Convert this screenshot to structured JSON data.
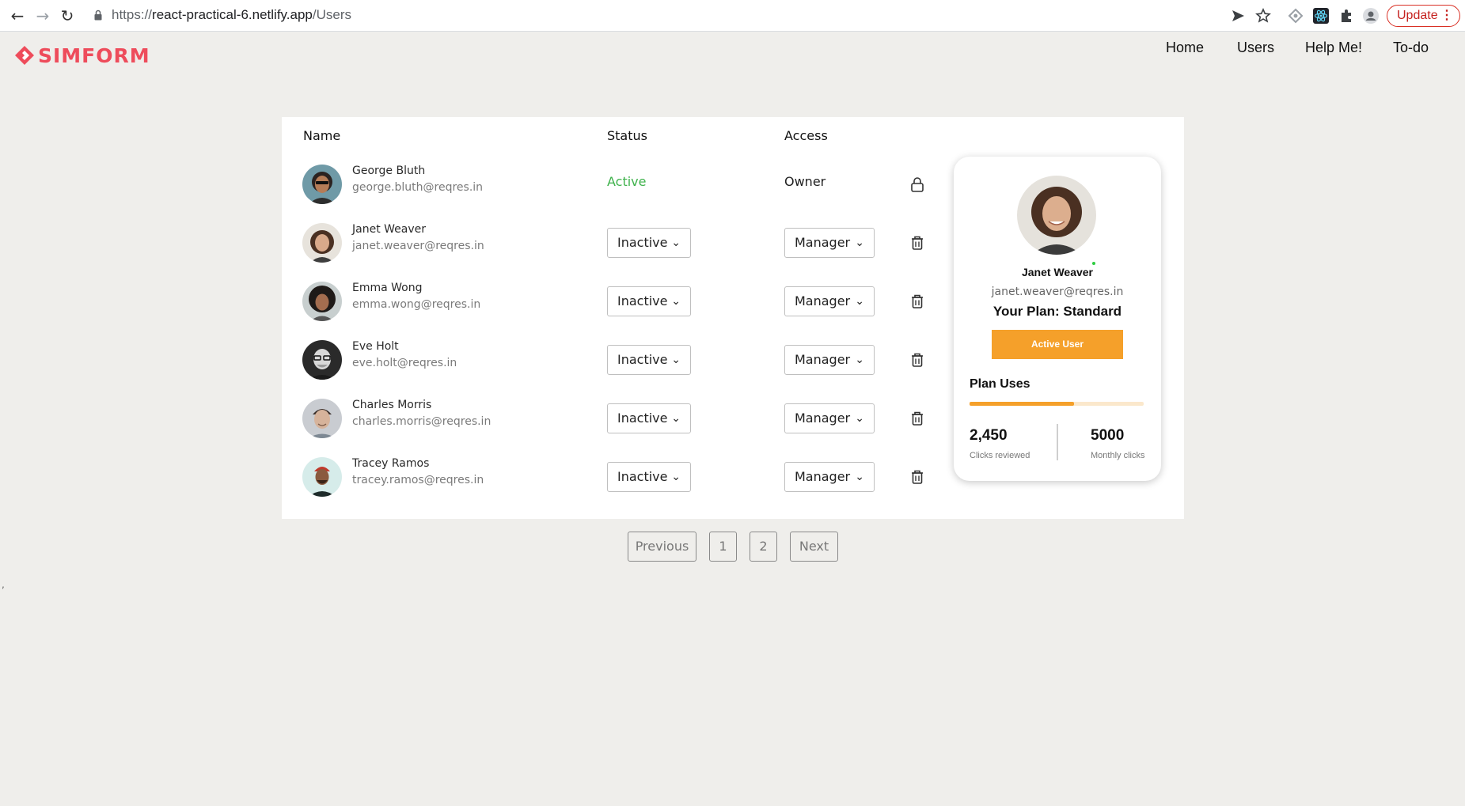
{
  "browser": {
    "url_prefix": "https://",
    "url_host": "react-practical-6.netlify.app",
    "url_path": "/Users",
    "update_label": "Update"
  },
  "brand": {
    "name": "SIMFORM",
    "color": "#ee4c5b"
  },
  "nav": [
    "Home",
    "Users",
    "Help Me!",
    "To-do"
  ],
  "table": {
    "headers": {
      "name": "Name",
      "status": "Status",
      "access": "Access"
    },
    "rows": [
      {
        "name": "George Bluth",
        "email": "george.bluth@reqres.in",
        "status": "Active",
        "access": "Owner",
        "editable": false,
        "action_icon": "lock-icon"
      },
      {
        "name": "Janet Weaver",
        "email": "janet.weaver@reqres.in",
        "status": "Inactive",
        "access": "Manager",
        "editable": true,
        "action_icon": "trash-icon"
      },
      {
        "name": "Emma Wong",
        "email": "emma.wong@reqres.in",
        "status": "Inactive",
        "access": "Manager",
        "editable": true,
        "action_icon": "trash-icon"
      },
      {
        "name": "Eve Holt",
        "email": "eve.holt@reqres.in",
        "status": "Inactive",
        "access": "Manager",
        "editable": true,
        "action_icon": "trash-icon"
      },
      {
        "name": "Charles Morris",
        "email": "charles.morris@reqres.in",
        "status": "Inactive",
        "access": "Manager",
        "editable": true,
        "action_icon": "trash-icon"
      },
      {
        "name": "Tracey Ramos",
        "email": "tracey.ramos@reqres.in",
        "status": "Inactive",
        "access": "Manager",
        "editable": true,
        "action_icon": "trash-icon"
      }
    ]
  },
  "profile_card": {
    "name": "Janet Weaver",
    "email": "janet.weaver@reqres.in",
    "plan": "Your Plan: Standard",
    "active_button": "Active User",
    "plan_uses_title": "Plan Uses",
    "plan_uses_fraction": 0.6,
    "stat1_value": "2,450",
    "stat1_label": "Clicks reviewed",
    "stat2_value": "5000",
    "stat2_label": "Monthly clicks",
    "accent_color": "#f5a02a"
  },
  "pagination": {
    "previous": "Previous",
    "pages": [
      "1",
      "2"
    ],
    "next": "Next"
  },
  "stray_text": ","
}
